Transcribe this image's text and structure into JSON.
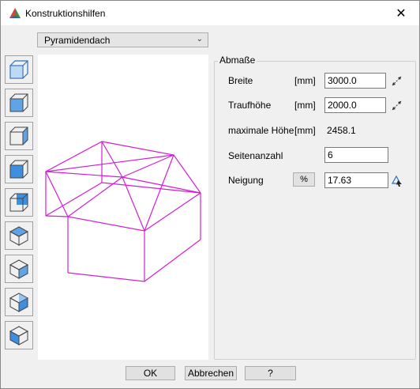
{
  "window": {
    "title": "Konstruktionshilfen",
    "close_label": "✕",
    "icon": "app-icon",
    "accent_color": "#e0267a"
  },
  "shape_select": {
    "selected": "Pyramidendach"
  },
  "toolbar": {
    "tools": [
      {
        "name": "box-outline-icon"
      },
      {
        "name": "box-front-face-icon"
      },
      {
        "name": "box-side-face-icon"
      },
      {
        "name": "box-front-filled-icon"
      },
      {
        "name": "box-corner-filled-icon"
      },
      {
        "name": "iso-top-icon"
      },
      {
        "name": "iso-left-icon"
      },
      {
        "name": "iso-right-icon"
      },
      {
        "name": "iso-bottom-icon"
      }
    ]
  },
  "abmasse": {
    "title": "Abmaße",
    "rows": {
      "breite": {
        "label": "Breite",
        "unit": "[mm]",
        "value": "3000.0"
      },
      "traufhoehe": {
        "label": "Traufhöhe",
        "unit": "[mm]",
        "value": "2000.0"
      },
      "max_hoehe": {
        "label": "maximale Höhe",
        "unit": "[mm]",
        "value": "2458.1"
      },
      "seitenanzahl": {
        "label": "Seitenanzahl",
        "value": "6"
      },
      "neigung": {
        "label": "Neigung",
        "unit_button": "%",
        "value": "17.63"
      }
    }
  },
  "footer": {
    "ok": "OK",
    "cancel": "Abbrechen",
    "help": "?"
  }
}
